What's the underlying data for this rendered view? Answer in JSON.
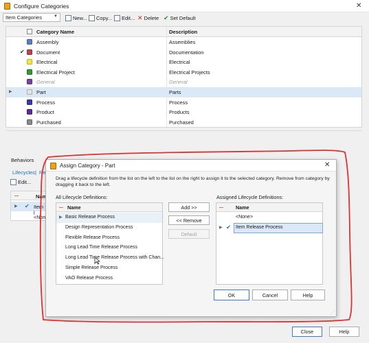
{
  "window": {
    "title": "Configure Categories"
  },
  "toolbar": {
    "combo_value": "Item Categories",
    "new_label": "New...",
    "copy_label": "Copy...",
    "edit_label": "Edit...",
    "delete_label": "Delete",
    "set_default_label": "Set Default"
  },
  "categories_table": {
    "columns": [
      "Category Name",
      "Description"
    ],
    "rows": [
      {
        "name": "Assembly",
        "description": "Assemblies",
        "color": "#5b7fc7"
      },
      {
        "name": "Document",
        "description": "Documentation",
        "color": "#c2404d"
      },
      {
        "name": "Electrical",
        "description": "Electrical",
        "color": "#f2ea3d"
      },
      {
        "name": "Electrical Project",
        "description": "Electrical Projects",
        "color": "#2f9a2f"
      },
      {
        "name": "General",
        "description": "General",
        "color": "#7b3fa8"
      },
      {
        "name": "Part",
        "description": "Parts",
        "color": "#e4e4e4"
      },
      {
        "name": "Process",
        "description": "Process",
        "color": "#3c3ca8"
      },
      {
        "name": "Product",
        "description": "Products",
        "color": "#5a2d92"
      },
      {
        "name": "Purchased",
        "description": "Purchased",
        "color": "#8a8a8a"
      }
    ]
  },
  "behaviors": {
    "title": "Behaviors",
    "tabs": [
      "Lifecycles",
      "Re"
    ],
    "edit_label": "Edit...",
    "inner_table": {
      "column": "Nam",
      "rows": [
        "Item l",
        "<Non"
      ]
    }
  },
  "dialog": {
    "title": "Assign Category - Part",
    "instructions": "Drag a lifecycle definition from the list on the left to the list on the right to assign it to the selected category. Remove from category by dragging it back to the left.",
    "left_label": "All Lifecycle Definitions:",
    "right_label": "Assigned Lifecycle Definitions:",
    "column_name": "Name",
    "all_definitions": [
      "Basic Release Process",
      "Design Representation Process",
      "Flexible Release Process",
      "Long Lead Time Release Process",
      "Long Lead Time Release Process with Chan...",
      "Simple Release Process",
      "VAO Release Process"
    ],
    "assigned_definitions": [
      "<None>",
      "Item Release Process"
    ],
    "add_label": "Add >>",
    "remove_label": "<< Remove",
    "default_label": "Default",
    "ok_label": "OK",
    "cancel_label": "Cancel",
    "help_label": "Help"
  },
  "footer": {
    "close_label": "Close",
    "help_label": "Help"
  },
  "annotation": {
    "color": "#e0302f"
  }
}
